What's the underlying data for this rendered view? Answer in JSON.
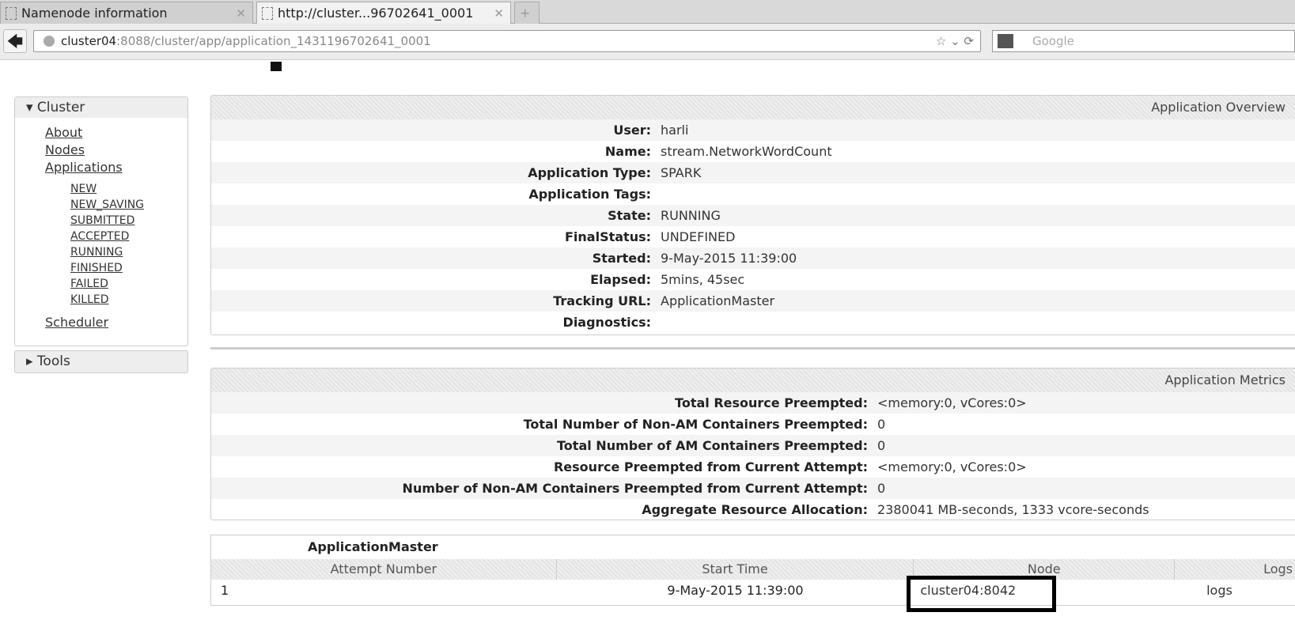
{
  "browser": {
    "tabs": [
      {
        "label": "Namenode information"
      },
      {
        "label": "http://cluster...96702641_0001"
      }
    ],
    "url_host": "cluster04",
    "url_rest": ":8088/cluster/app/application_1431196702641_0001",
    "search_placeholder": "Google"
  },
  "sidebar": {
    "cluster": "▾ Cluster",
    "items": [
      "About",
      "Nodes",
      "Applications"
    ],
    "states": [
      "NEW",
      "NEW_SAVING",
      "SUBMITTED",
      "ACCEPTED",
      "RUNNING",
      "FINISHED",
      "FAILED",
      "KILLED"
    ],
    "scheduler": "Scheduler",
    "tools": "▸ Tools"
  },
  "overview": {
    "title": "Application Overview",
    "rows": [
      {
        "k": "User:",
        "v": "harli"
      },
      {
        "k": "Name:",
        "v": "stream.NetworkWordCount"
      },
      {
        "k": "Application Type:",
        "v": "SPARK"
      },
      {
        "k": "Application Tags:",
        "v": ""
      },
      {
        "k": "State:",
        "v": "RUNNING"
      },
      {
        "k": "FinalStatus:",
        "v": "UNDEFINED"
      },
      {
        "k": "Started:",
        "v": "9-May-2015 11:39:00"
      },
      {
        "k": "Elapsed:",
        "v": "5mins, 45sec"
      },
      {
        "k": "Tracking URL:",
        "v": "ApplicationMaster"
      },
      {
        "k": "Diagnostics:",
        "v": ""
      }
    ]
  },
  "metrics": {
    "title": "Application Metrics",
    "rows": [
      {
        "k": "Total Resource Preempted:",
        "v": "<memory:0, vCores:0>"
      },
      {
        "k": "Total Number of Non-AM Containers Preempted:",
        "v": "0"
      },
      {
        "k": "Total Number of AM Containers Preempted:",
        "v": "0"
      },
      {
        "k": "Resource Preempted from Current Attempt:",
        "v": "<memory:0, vCores:0>"
      },
      {
        "k": "Number of Non-AM Containers Preempted from Current Attempt:",
        "v": "0"
      },
      {
        "k": "Aggregate Resource Allocation:",
        "v": "2380041 MB-seconds, 1333 vcore-seconds"
      }
    ]
  },
  "am": {
    "title": "ApplicationMaster",
    "headers": [
      "Attempt Number",
      "Start Time",
      "Node",
      "Logs"
    ],
    "row": [
      "1",
      "9-May-2015 11:39:00",
      "cluster04:8042",
      "logs"
    ]
  }
}
